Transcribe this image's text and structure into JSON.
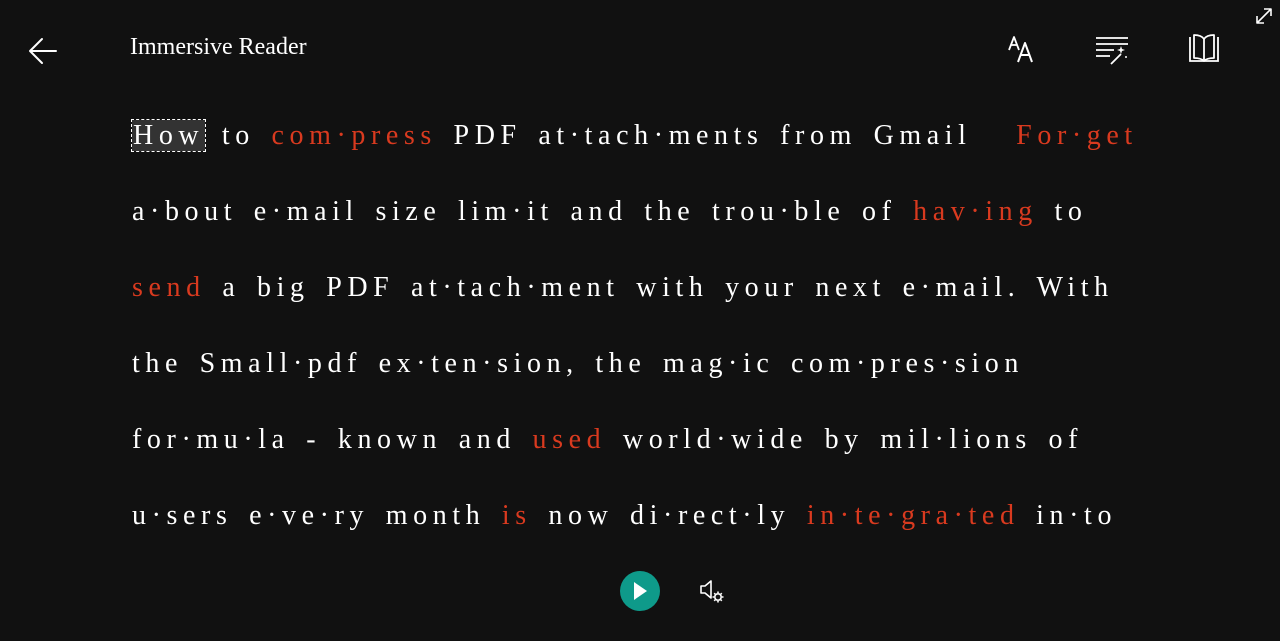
{
  "app": {
    "title": "Immersive Reader"
  },
  "icons": {
    "back": "back-arrow-icon",
    "text_preferences": "text-preferences-icon",
    "grammar_options": "grammar-options-icon",
    "reading_preferences": "reading-preferences-icon",
    "fullscreen": "fullscreen-icon",
    "play": "play-icon",
    "voice_settings": "voice-settings-icon"
  },
  "colors": {
    "background": "#111111",
    "text": "#ffffff",
    "verb_highlight": "#d93a1f",
    "play_button": "#0e9a8a",
    "current_word_bg": "#333333"
  },
  "reader": {
    "lines": [
      [
        {
          "t": "How",
          "v": false,
          "cur": true
        },
        {
          "t": "to",
          "v": false
        },
        {
          "t": "com·press",
          "v": true
        },
        {
          "t": "PDF",
          "v": false
        },
        {
          "t": "at·tach·ments",
          "v": false
        },
        {
          "t": "from",
          "v": false
        },
        {
          "t": "Gmail",
          "v": false,
          "gap": true
        },
        {
          "t": "For·get",
          "v": true
        }
      ],
      [
        {
          "t": "a·bout",
          "v": false
        },
        {
          "t": "e·mail",
          "v": false
        },
        {
          "t": "size",
          "v": false
        },
        {
          "t": "lim·it",
          "v": false
        },
        {
          "t": "and",
          "v": false
        },
        {
          "t": "the",
          "v": false
        },
        {
          "t": "trou·ble",
          "v": false
        },
        {
          "t": "of",
          "v": false
        },
        {
          "t": "hav·ing",
          "v": true
        },
        {
          "t": "to",
          "v": false
        }
      ],
      [
        {
          "t": "send",
          "v": true
        },
        {
          "t": "a",
          "v": false
        },
        {
          "t": "big",
          "v": false
        },
        {
          "t": "PDF",
          "v": false
        },
        {
          "t": "at·tach·ment",
          "v": false
        },
        {
          "t": "with",
          "v": false
        },
        {
          "t": "your",
          "v": false
        },
        {
          "t": "next",
          "v": false
        },
        {
          "t": "e·mail.",
          "v": false
        },
        {
          "t": "With",
          "v": false
        }
      ],
      [
        {
          "t": "the",
          "v": false
        },
        {
          "t": "Small·pdf",
          "v": false
        },
        {
          "t": "ex·ten·sion,",
          "v": false
        },
        {
          "t": "the",
          "v": false
        },
        {
          "t": "mag·ic",
          "v": false
        },
        {
          "t": "com·pres·sion",
          "v": false
        }
      ],
      [
        {
          "t": "for·mu·la",
          "v": false
        },
        {
          "t": "-",
          "v": false
        },
        {
          "t": "known",
          "v": false
        },
        {
          "t": "and",
          "v": false
        },
        {
          "t": "used",
          "v": true
        },
        {
          "t": "world·wide",
          "v": false
        },
        {
          "t": "by",
          "v": false
        },
        {
          "t": "mil·lions",
          "v": false
        },
        {
          "t": "of",
          "v": false
        }
      ],
      [
        {
          "t": "u·sers",
          "v": false
        },
        {
          "t": "e·ve·ry",
          "v": false
        },
        {
          "t": "month",
          "v": false
        },
        {
          "t": "is",
          "v": true
        },
        {
          "t": "now",
          "v": false
        },
        {
          "t": "di·rect·ly",
          "v": false
        },
        {
          "t": "in·te·gra·ted",
          "v": true
        },
        {
          "t": "in·to",
          "v": false
        }
      ]
    ]
  }
}
